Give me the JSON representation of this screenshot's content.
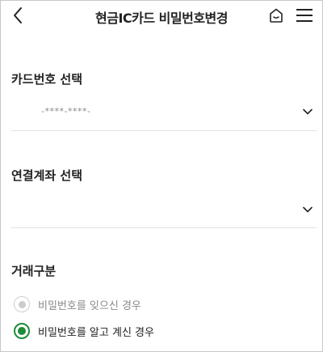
{
  "header": {
    "title": "현금IC카드 비밀번호변경",
    "back_icon": "chevron-left-icon",
    "home_icon": "home-icon",
    "menu_icon": "hamburger-menu-icon"
  },
  "card_section": {
    "label": "카드번호 선택",
    "value": "-****-****-"
  },
  "account_section": {
    "label": "연결계좌 선택",
    "value": ""
  },
  "transaction_section": {
    "label": "거래구분",
    "options": [
      {
        "label": "비밀번호를 잊으신 경우",
        "state": "disabled"
      },
      {
        "label": "비밀번호를 알고 계신 경우",
        "state": "checked"
      }
    ]
  },
  "colors": {
    "accent": "#1f8b3a",
    "disabled": "#cccccc",
    "divider": "#e2e2e2"
  }
}
